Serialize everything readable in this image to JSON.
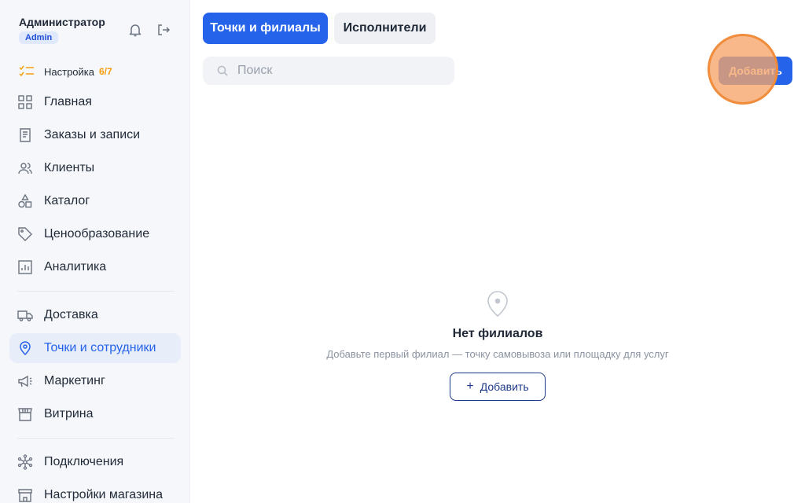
{
  "user": {
    "name": "Администратор",
    "role": "Admin"
  },
  "setup": {
    "label": "Настройка",
    "count": "6/7"
  },
  "nav": {
    "items": [
      {
        "label": "Главная",
        "icon": "grid-icon"
      },
      {
        "label": "Заказы и записи",
        "icon": "receipt-icon"
      },
      {
        "label": "Клиенты",
        "icon": "users-icon"
      },
      {
        "label": "Каталог",
        "icon": "shapes-icon"
      },
      {
        "label": "Ценообразование",
        "icon": "tag-icon"
      },
      {
        "label": "Аналитика",
        "icon": "chart-icon"
      },
      {
        "label": "Доставка",
        "icon": "truck-icon"
      },
      {
        "label": "Точки и сотрудники",
        "icon": "map-pin-icon",
        "active": true
      },
      {
        "label": "Маркетинг",
        "icon": "megaphone-icon"
      },
      {
        "label": "Витрина",
        "icon": "store-icon"
      },
      {
        "label": "Подключения",
        "icon": "network-icon"
      },
      {
        "label": "Настройки магазина",
        "icon": "shop-settings-icon"
      }
    ]
  },
  "tabs": [
    {
      "label": "Точки и филиалы",
      "active": true
    },
    {
      "label": "Исполнители",
      "active": false
    }
  ],
  "search": {
    "placeholder": "Поиск",
    "value": ""
  },
  "toolbar": {
    "add_label": "Добавить"
  },
  "empty_state": {
    "title": "Нет филиалов",
    "subtitle": "Добавьте первый филиал — точку самовывоза или площадку для услуг",
    "button_label": "Добавить"
  },
  "colors": {
    "accent": "#2563eb",
    "active_bg": "#e7edf9",
    "warning": "#f59e0b",
    "click_marker": "#f08c3b"
  }
}
